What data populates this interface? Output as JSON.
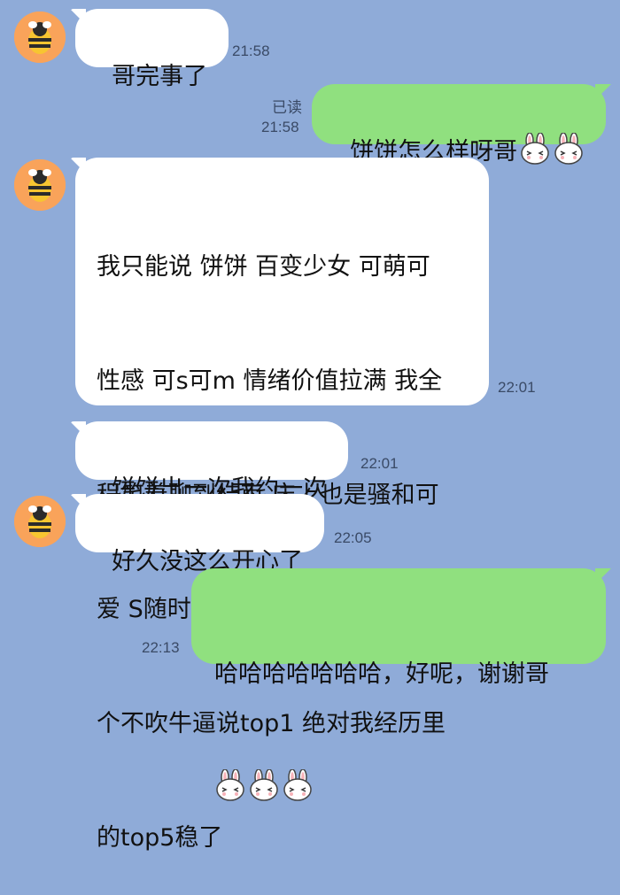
{
  "chat": {
    "avatar_icon": "bee-avatar-icon",
    "sticker_icon": "white-bunny-sticker-icon",
    "colors": {
      "background": "#8fabd8",
      "incoming_bubble": "#ffffff",
      "outgoing_bubble": "#90e07f",
      "avatar": "#f9a35a"
    },
    "messages": [
      {
        "text": "哥完事了",
        "time": "21:58"
      },
      {
        "text": "饼饼怎么样呀哥",
        "read": "已读",
        "time": "21:58"
      },
      {
        "lines": [
          "我只能说 饼饼 百变少女 可萌可",
          "性感 可s可m 情绪价值拉满 我全",
          "程笑着聊到结束 床上也是骚和可",
          "爱 S随时切换 玩了也有10年了 这",
          "个不吹牛逼说top1 绝对我经历里",
          "的top5稳了"
        ],
        "time": "22:01"
      },
      {
        "text": "饼饼出一次我约一次",
        "time": "22:01"
      },
      {
        "text": "好久没这么开心了",
        "time": "22:05"
      },
      {
        "text": "哈哈哈哈哈哈哈，好呢，谢谢哥",
        "time": "22:13"
      }
    ]
  }
}
